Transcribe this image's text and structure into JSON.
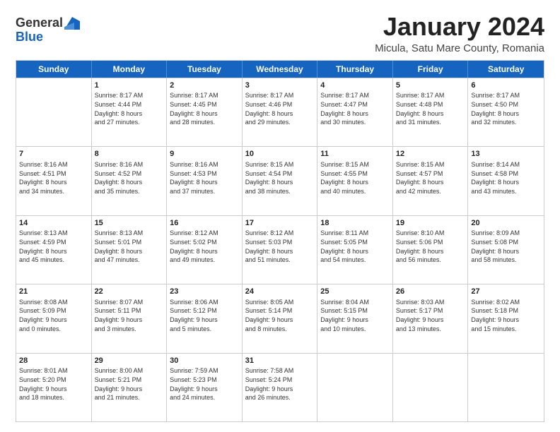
{
  "logo": {
    "general": "General",
    "blue": "Blue"
  },
  "title": "January 2024",
  "subtitle": "Micula, Satu Mare County, Romania",
  "header_days": [
    "Sunday",
    "Monday",
    "Tuesday",
    "Wednesday",
    "Thursday",
    "Friday",
    "Saturday"
  ],
  "weeks": [
    [
      {
        "day": "",
        "info": ""
      },
      {
        "day": "1",
        "info": "Sunrise: 8:17 AM\nSunset: 4:44 PM\nDaylight: 8 hours\nand 27 minutes."
      },
      {
        "day": "2",
        "info": "Sunrise: 8:17 AM\nSunset: 4:45 PM\nDaylight: 8 hours\nand 28 minutes."
      },
      {
        "day": "3",
        "info": "Sunrise: 8:17 AM\nSunset: 4:46 PM\nDaylight: 8 hours\nand 29 minutes."
      },
      {
        "day": "4",
        "info": "Sunrise: 8:17 AM\nSunset: 4:47 PM\nDaylight: 8 hours\nand 30 minutes."
      },
      {
        "day": "5",
        "info": "Sunrise: 8:17 AM\nSunset: 4:48 PM\nDaylight: 8 hours\nand 31 minutes."
      },
      {
        "day": "6",
        "info": "Sunrise: 8:17 AM\nSunset: 4:50 PM\nDaylight: 8 hours\nand 32 minutes."
      }
    ],
    [
      {
        "day": "7",
        "info": ""
      },
      {
        "day": "8",
        "info": "Sunrise: 8:16 AM\nSunset: 4:52 PM\nDaylight: 8 hours\nand 35 minutes."
      },
      {
        "day": "9",
        "info": "Sunrise: 8:16 AM\nSunset: 4:53 PM\nDaylight: 8 hours\nand 37 minutes."
      },
      {
        "day": "10",
        "info": "Sunrise: 8:15 AM\nSunset: 4:54 PM\nDaylight: 8 hours\nand 38 minutes."
      },
      {
        "day": "11",
        "info": "Sunrise: 8:15 AM\nSunset: 4:55 PM\nDaylight: 8 hours\nand 40 minutes."
      },
      {
        "day": "12",
        "info": "Sunrise: 8:15 AM\nSunset: 4:57 PM\nDaylight: 8 hours\nand 42 minutes."
      },
      {
        "day": "13",
        "info": "Sunrise: 8:14 AM\nSunset: 4:58 PM\nDaylight: 8 hours\nand 43 minutes."
      }
    ],
    [
      {
        "day": "14",
        "info": ""
      },
      {
        "day": "15",
        "info": "Sunrise: 8:13 AM\nSunset: 5:01 PM\nDaylight: 8 hours\nand 47 minutes."
      },
      {
        "day": "16",
        "info": "Sunrise: 8:12 AM\nSunset: 5:02 PM\nDaylight: 8 hours\nand 49 minutes."
      },
      {
        "day": "17",
        "info": "Sunrise: 8:12 AM\nSunset: 5:03 PM\nDaylight: 8 hours\nand 51 minutes."
      },
      {
        "day": "18",
        "info": "Sunrise: 8:11 AM\nSunset: 5:05 PM\nDaylight: 8 hours\nand 54 minutes."
      },
      {
        "day": "19",
        "info": "Sunrise: 8:10 AM\nSunset: 5:06 PM\nDaylight: 8 hours\nand 56 minutes."
      },
      {
        "day": "20",
        "info": "Sunrise: 8:09 AM\nSunset: 5:08 PM\nDaylight: 8 hours\nand 58 minutes."
      }
    ],
    [
      {
        "day": "21",
        "info": "Sunrise: 8:08 AM\nSunset: 5:09 PM\nDaylight: 9 hours\nand 0 minutes."
      },
      {
        "day": "22",
        "info": "Sunrise: 8:07 AM\nSunset: 5:11 PM\nDaylight: 9 hours\nand 3 minutes."
      },
      {
        "day": "23",
        "info": "Sunrise: 8:06 AM\nSunset: 5:12 PM\nDaylight: 9 hours\nand 5 minutes."
      },
      {
        "day": "24",
        "info": "Sunrise: 8:05 AM\nSunset: 5:14 PM\nDaylight: 9 hours\nand 8 minutes."
      },
      {
        "day": "25",
        "info": "Sunrise: 8:04 AM\nSunset: 5:15 PM\nDaylight: 9 hours\nand 10 minutes."
      },
      {
        "day": "26",
        "info": "Sunrise: 8:03 AM\nSunset: 5:17 PM\nDaylight: 9 hours\nand 13 minutes."
      },
      {
        "day": "27",
        "info": "Sunrise: 8:02 AM\nSunset: 5:18 PM\nDaylight: 9 hours\nand 15 minutes."
      }
    ],
    [
      {
        "day": "28",
        "info": "Sunrise: 8:01 AM\nSunset: 5:20 PM\nDaylight: 9 hours\nand 18 minutes."
      },
      {
        "day": "29",
        "info": "Sunrise: 8:00 AM\nSunset: 5:21 PM\nDaylight: 9 hours\nand 21 minutes."
      },
      {
        "day": "30",
        "info": "Sunrise: 7:59 AM\nSunset: 5:23 PM\nDaylight: 9 hours\nand 24 minutes."
      },
      {
        "day": "31",
        "info": "Sunrise: 7:58 AM\nSunset: 5:24 PM\nDaylight: 9 hours\nand 26 minutes."
      },
      {
        "day": "",
        "info": ""
      },
      {
        "day": "",
        "info": ""
      },
      {
        "day": "",
        "info": ""
      }
    ]
  ],
  "week1_sun_info": "Sunrise: 8:16 AM\nSunset: 4:51 PM\nDaylight: 8 hours\nand 34 minutes.",
  "week3_sun_info": "Sunrise: 8:13 AM\nSunset: 4:59 PM\nDaylight: 8 hours\nand 45 minutes."
}
